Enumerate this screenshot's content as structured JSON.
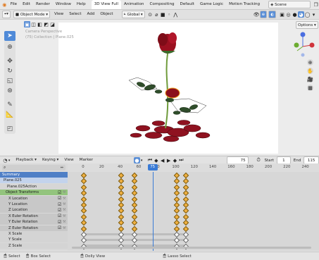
{
  "menubar": {
    "items": [
      "File",
      "Edit",
      "Render",
      "Window",
      "Help"
    ],
    "workspaces": [
      "3D View Full",
      "Animation",
      "Compositing",
      "Default",
      "Game Logic",
      "Motion Tracking"
    ],
    "active_workspace": "3D View Full",
    "scene_label": "Scene"
  },
  "viewport_header": {
    "mode": "Object Mode",
    "menus": [
      "View",
      "Select",
      "Add",
      "Object"
    ],
    "orientation": "Global",
    "options_label": "Options"
  },
  "viewport": {
    "overlay_line1": "Camera Perspective",
    "overlay_line2": "(75) Collection | Plane.025"
  },
  "dopesheet_header": {
    "menus": [
      "Playback",
      "Keying",
      "View",
      "Marker"
    ],
    "current_frame": "75",
    "start_label": "Start",
    "start_value": "1",
    "end_label": "End",
    "end_value": "115"
  },
  "ruler": {
    "ticks": [
      "0",
      "20",
      "40",
      "60",
      "80",
      "100",
      "120",
      "140",
      "160",
      "180",
      "200",
      "220",
      "240"
    ],
    "playhead_frame": "75"
  },
  "channels": [
    {
      "label": "Summary",
      "kind": "summary"
    },
    {
      "label": "Plane.025",
      "kind": "object"
    },
    {
      "label": "Plane.025Action",
      "kind": "action"
    },
    {
      "label": "Object Transforms",
      "kind": "group"
    },
    {
      "label": "X Location",
      "kind": "fcurve"
    },
    {
      "label": "Y Location",
      "kind": "fcurve"
    },
    {
      "label": "Z Location",
      "kind": "fcurve"
    },
    {
      "label": "X Euler Rotation",
      "kind": "fcurve"
    },
    {
      "label": "Y Euler Rotation",
      "kind": "fcurve"
    },
    {
      "label": "Z Euler Rotation",
      "kind": "fcurve"
    },
    {
      "label": "X Scale",
      "kind": "fcurve-plain"
    },
    {
      "label": "Y Scale",
      "kind": "fcurve-plain"
    },
    {
      "label": "Z Scale",
      "kind": "fcurve-plain"
    }
  ],
  "key_frames": [
    "0",
    "40",
    "55",
    "100",
    "110"
  ],
  "statusbar": {
    "items": [
      "Select",
      "Box Select",
      "Dolly View",
      "Lasso Select"
    ]
  },
  "colors": {
    "accent": "#4f8ad8",
    "keyframe": "#f0b040",
    "playhead": "#3a7bd5",
    "rose_red": "#9b1020"
  }
}
